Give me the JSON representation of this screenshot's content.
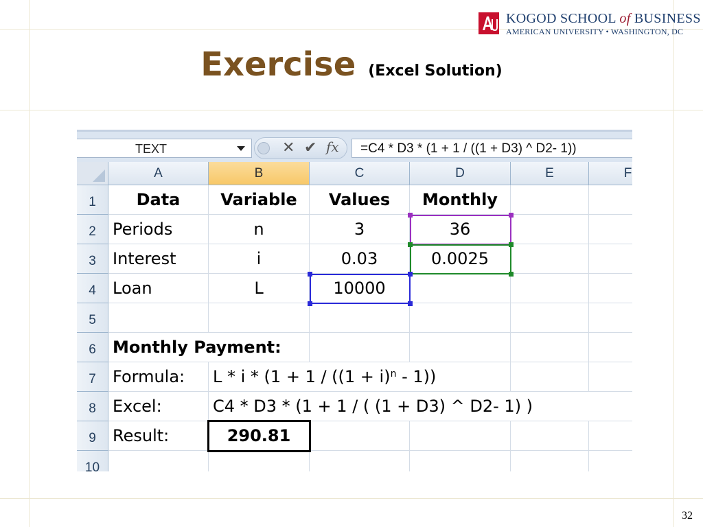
{
  "logo": {
    "line1_a": "KOGOD SCHOOL",
    "line1_of": "of",
    "line1_b": "BUSINESS",
    "line2": "AMERICAN UNIVERSITY • WASHINGTON, DC",
    "brand_color": "#1f3f6e",
    "accent_color": "#c8102e"
  },
  "slide": {
    "title": "Exercise",
    "subtitle": "(Excel Solution)",
    "page_number": "32"
  },
  "excel": {
    "name_box": "TEXT",
    "formula": "=C4 * D3 * (1 + 1 / ((1 + D3) ^ D2- 1))",
    "icons": [
      "dropdown-icon",
      "cancel-x-icon",
      "enter-check-icon",
      "function-fx-icon"
    ],
    "columns": [
      "A",
      "B",
      "C",
      "D",
      "E",
      "F"
    ],
    "rows": [
      "1",
      "2",
      "3",
      "4",
      "5",
      "6",
      "7",
      "8",
      "9",
      "10"
    ],
    "cells": {
      "A1": "Data",
      "B1": "Variable",
      "C1": "Values",
      "D1": "Monthly",
      "A2": "Periods",
      "B2": "n",
      "C2": "3",
      "D2": "36",
      "A3": "Interest",
      "B3": "i",
      "C3": "0.03",
      "D3": "0.0025",
      "A4": "Loan",
      "B4": "L",
      "C4": "10000",
      "A6": "Monthly Payment:",
      "A7": "Formula:",
      "B7_pre": "L * i * (1 + 1 / ((1 + i)",
      "B7_sup": "n",
      "B7_post": " - 1))",
      "A8": "Excel:",
      "B8": "C4 * D3 * (1 + 1 / ( (1 + D3) ^ D2- 1) )",
      "A9": "Result:",
      "B9": "290.81"
    },
    "selected_column": "B",
    "reference_colors": {
      "C4": "#2a2ad8",
      "D3": "#1f8a2a",
      "D2": "#9b30c0"
    }
  }
}
